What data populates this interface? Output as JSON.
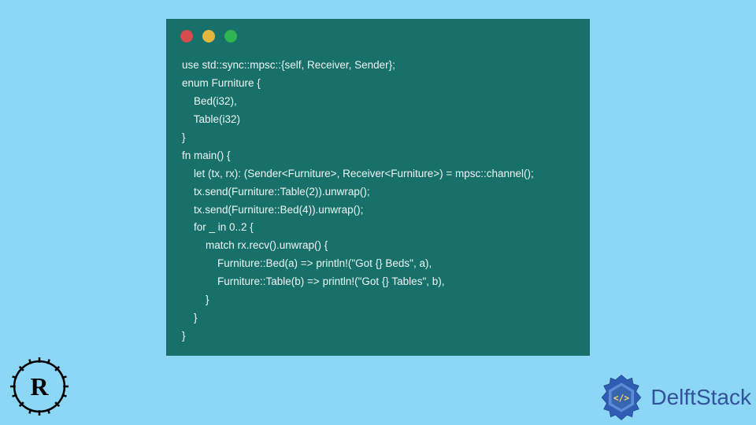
{
  "code": {
    "line1": "use std::sync::mpsc::{self, Receiver, Sender};",
    "line2": "enum Furniture {",
    "line3": "    Bed(i32),",
    "line4": "    Table(i32)",
    "line5": "}",
    "line6": "fn main() {",
    "line7": "    let (tx, rx): (Sender<Furniture>, Receiver<Furniture>) = mpsc::channel();",
    "line8": "    tx.send(Furniture::Table(2)).unwrap();",
    "line9": "    tx.send(Furniture::Bed(4)).unwrap();",
    "line10": "    for _ in 0..2 {",
    "line11": "        match rx.recv().unwrap() {",
    "line12": "            Furniture::Bed(a) => println!(\"Got {} Beds\", a),",
    "line13": "            Furniture::Table(b) => println!(\"Got {} Tables\", b),",
    "line14": "        }",
    "line15": "    }",
    "line16": "}"
  },
  "brand": {
    "delftstack": "DelftStack"
  }
}
